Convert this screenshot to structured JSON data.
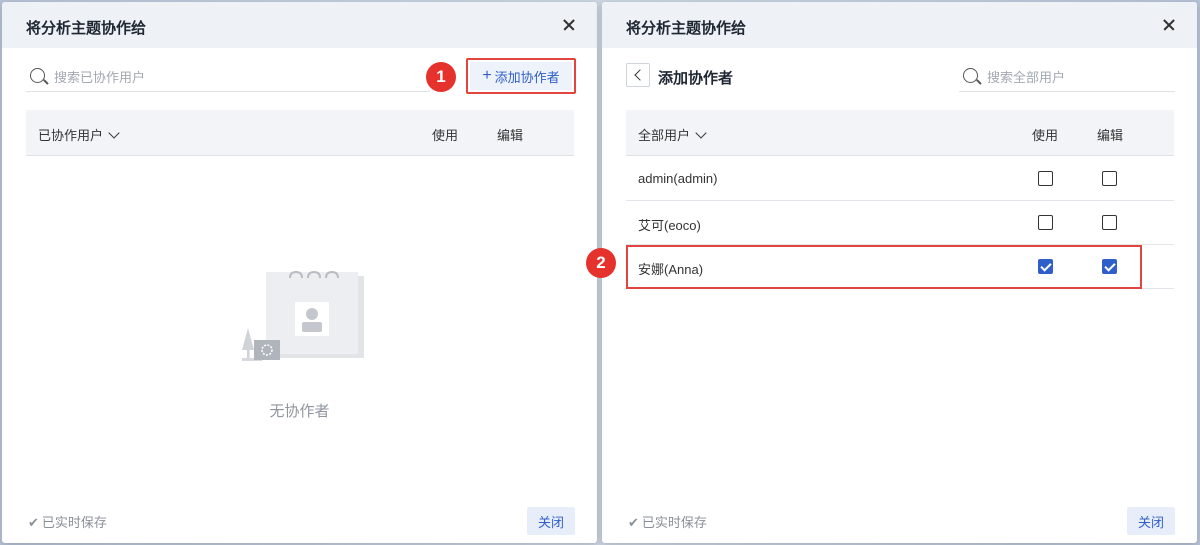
{
  "left": {
    "title": "将分析主题协作给",
    "search_placeholder": "搜索已协作用户",
    "add_button_label": "添加协作者",
    "step1": "1",
    "table": {
      "col_user": "已协作用户",
      "col_use": "使用",
      "col_edit": "编辑"
    },
    "empty_text": "无协作者",
    "saved_text": "已实时保存",
    "close_label": "关闭"
  },
  "right": {
    "title": "将分析主题协作给",
    "sub_title": "添加协作者",
    "search_placeholder": "搜索全部用户",
    "step2": "2",
    "table": {
      "col_user": "全部用户",
      "col_use": "使用",
      "col_edit": "编辑"
    },
    "rows": [
      {
        "name": "admin(admin)",
        "use": false,
        "edit": false
      },
      {
        "name": "艾可(eoco)",
        "use": false,
        "edit": false
      },
      {
        "name": "安娜(Anna)",
        "use": true,
        "edit": true
      }
    ],
    "saved_text": "已实时保存",
    "close_label": "关闭"
  },
  "colors": {
    "accent": "#2f5fc9",
    "highlight": "#e2453f",
    "badge": "#e5322d"
  }
}
